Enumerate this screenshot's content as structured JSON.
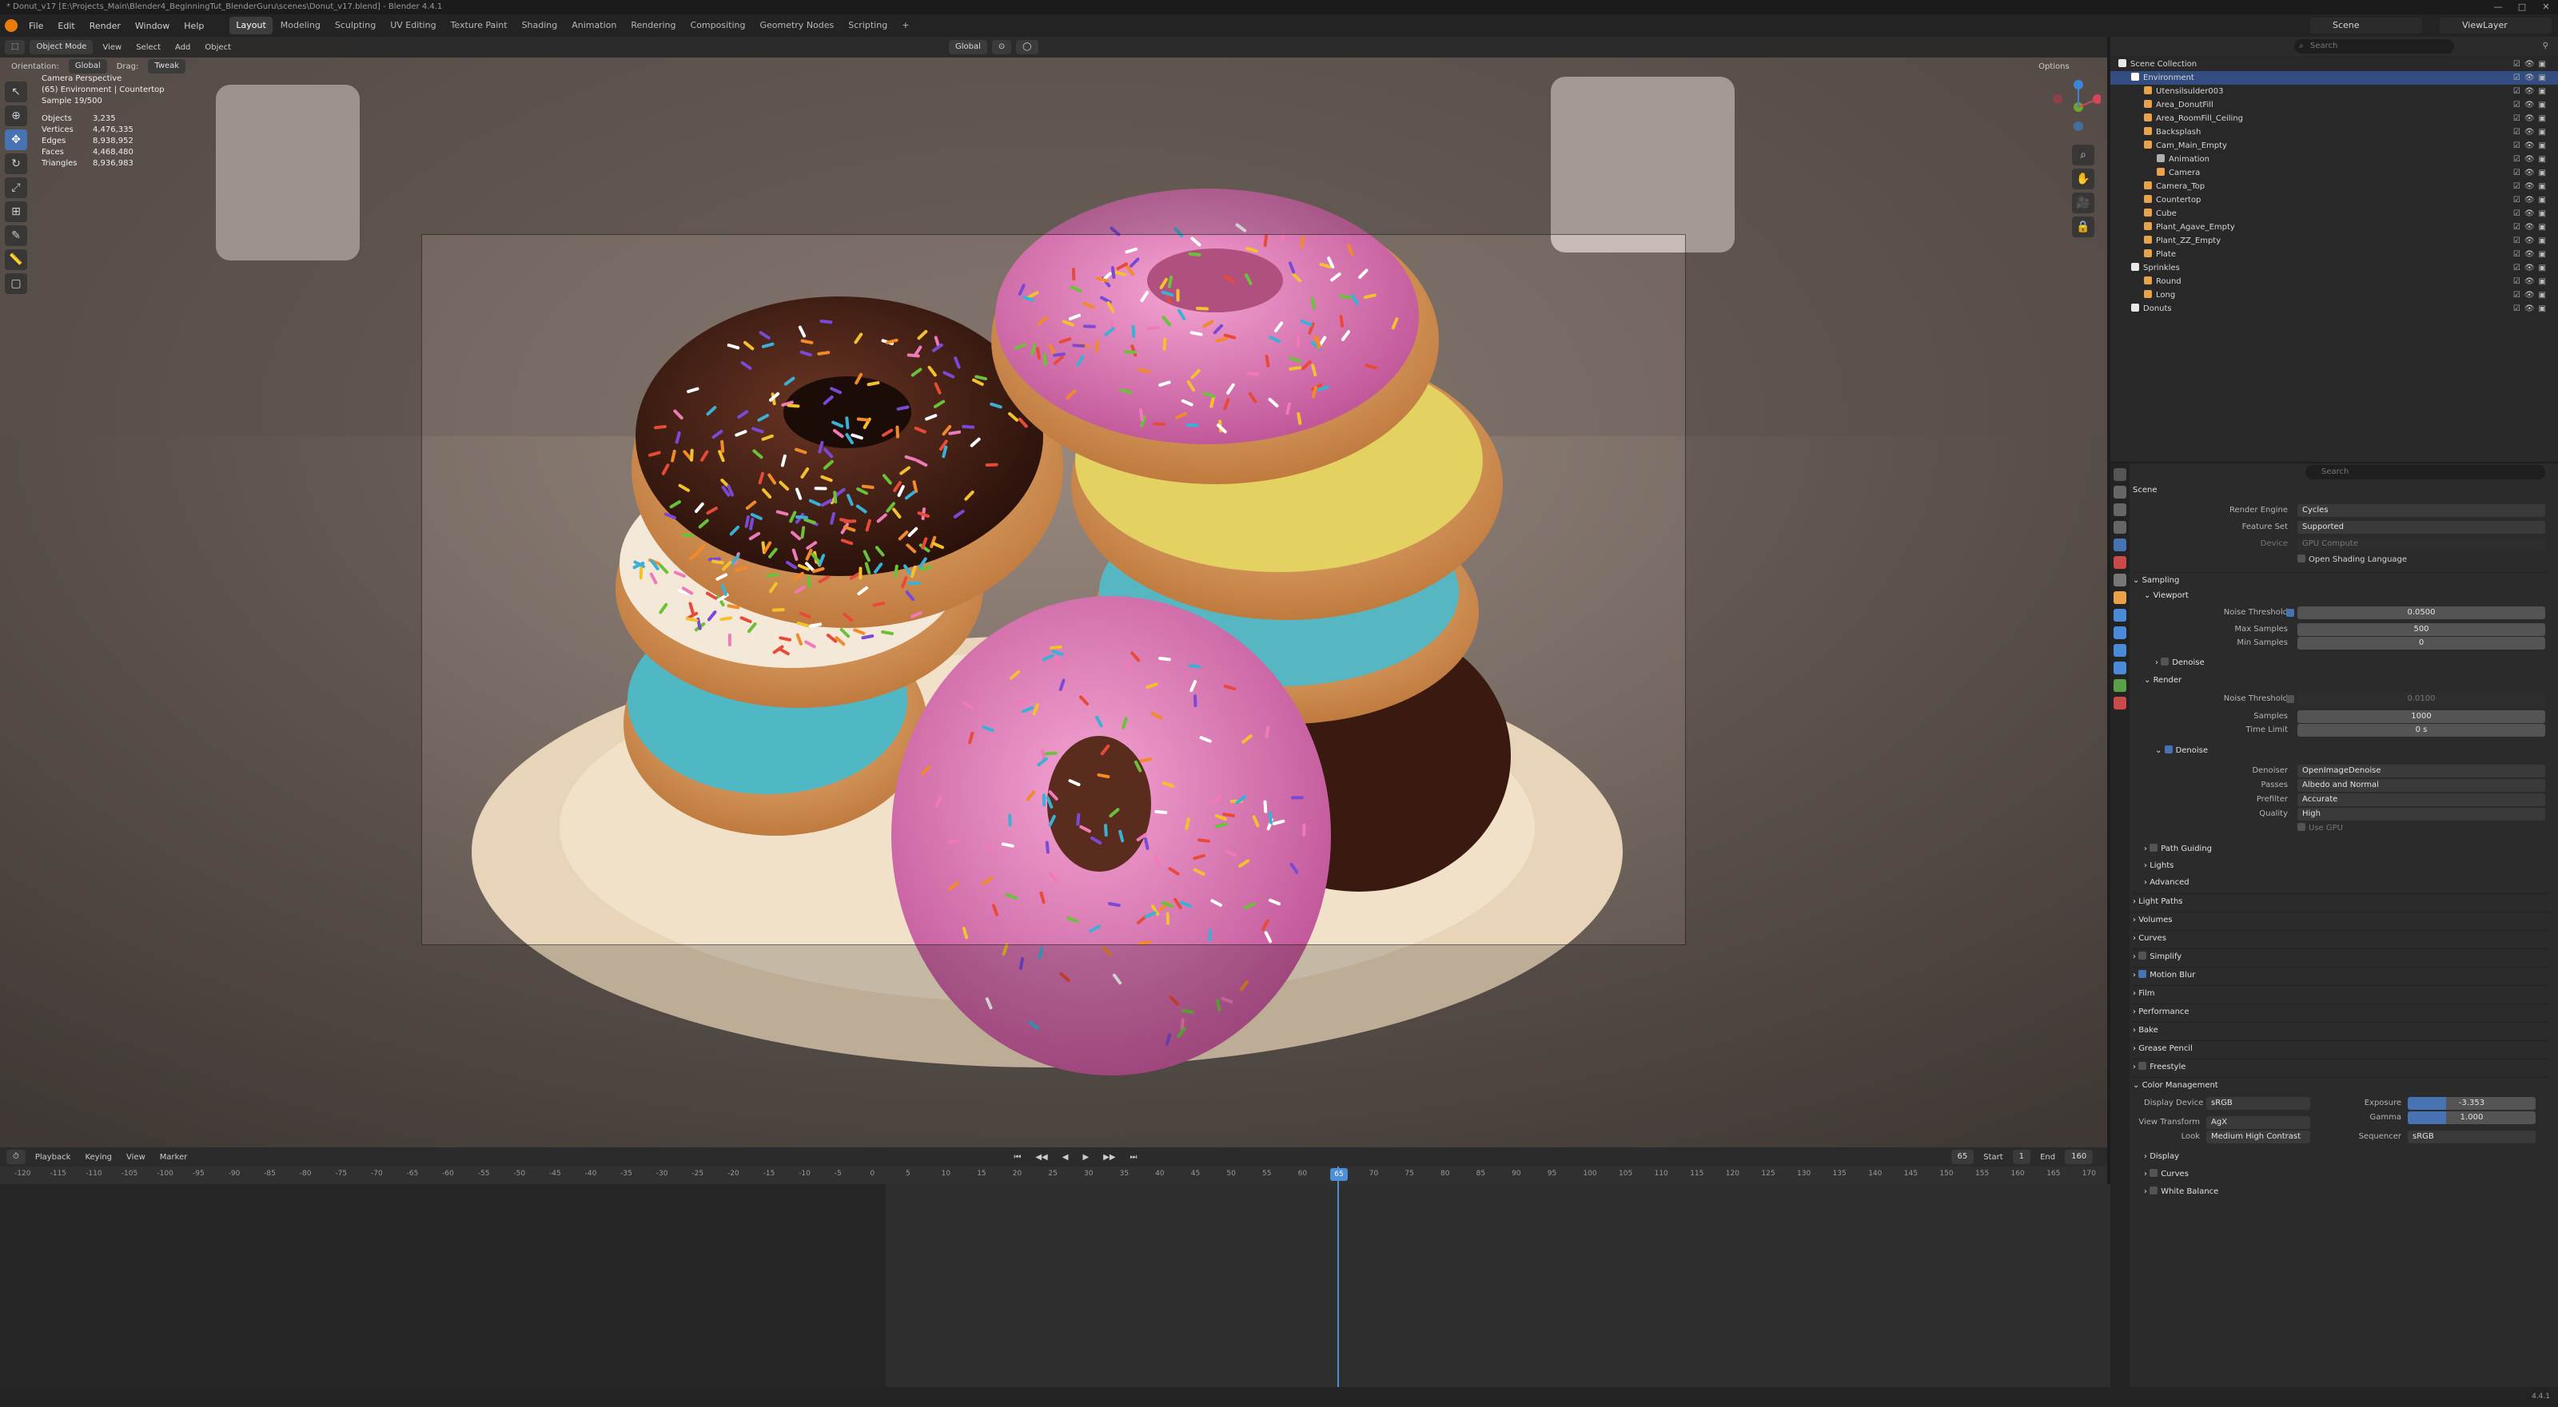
{
  "window": {
    "title": "* Donut_v17 [E:\\Projects_Main\\Blender4_BeginningTut_BlenderGuru\\scenes\\Donut_v17.blend] - Blender 4.4.1",
    "controls": [
      "—",
      "□",
      "✕"
    ]
  },
  "menu": {
    "items": [
      "File",
      "Edit",
      "Render",
      "Window",
      "Help"
    ],
    "workspaces": [
      "Layout",
      "Modeling",
      "Sculpting",
      "UV Editing",
      "Texture Paint",
      "Shading",
      "Animation",
      "Rendering",
      "Compositing",
      "Geometry Nodes",
      "Scripting"
    ],
    "active_workspace": "Layout",
    "add_workspace": "+",
    "scene": "Scene",
    "view_layer": "ViewLayer"
  },
  "viewport": {
    "mode": "Object Mode",
    "menus": [
      "View",
      "Select",
      "Add",
      "Object"
    ],
    "orientation_label": "Orientation:",
    "orientation": "Global",
    "drag_label": "Drag:",
    "drag": "Tweak",
    "transform": "Global",
    "options": "Options",
    "camera_info": [
      "Camera Perspective",
      "(65) Environment | Countertop",
      "Sample 19/500"
    ],
    "stats": [
      {
        "label": "Objects",
        "value": "3,235"
      },
      {
        "label": "Vertices",
        "value": "4,476,335"
      },
      {
        "label": "Edges",
        "value": "8,938,952"
      },
      {
        "label": "Faces",
        "value": "4,468,480"
      },
      {
        "label": "Triangles",
        "value": "8,936,983"
      }
    ]
  },
  "timeline": {
    "menus": [
      "Playback",
      "Keying",
      "View",
      "Marker"
    ],
    "current_frame": "65",
    "start_label": "Start",
    "start": "1",
    "end_label": "End",
    "end": "160",
    "ticks": [
      "-120",
      "-115",
      "-110",
      "-105",
      "-100",
      "-95",
      "-90",
      "-85",
      "-80",
      "-75",
      "-70",
      "-65",
      "-60",
      "-55",
      "-50",
      "-45",
      "-40",
      "-35",
      "-30",
      "-25",
      "-20",
      "-15",
      "-10",
      "-5",
      "0",
      "5",
      "10",
      "15",
      "20",
      "25",
      "30",
      "35",
      "40",
      "45",
      "50",
      "55",
      "60",
      "65",
      "70",
      "75",
      "80",
      "85",
      "90",
      "95",
      "100",
      "105",
      "110",
      "115",
      "120",
      "125",
      "130",
      "135",
      "140",
      "145",
      "150",
      "155",
      "160",
      "165",
      "170"
    ]
  },
  "outliner": {
    "search_placeholder": "Search",
    "rows": [
      {
        "label": "Scene Collection",
        "indent": 0,
        "color": "#e8e8e8"
      },
      {
        "label": "Environment",
        "indent": 1,
        "color": "#ffffff",
        "selected": true
      },
      {
        "label": "Utensilsulder003",
        "indent": 2,
        "color": "#e8a24a"
      },
      {
        "label": "Area_DonutFill",
        "indent": 2,
        "color": "#e8a24a"
      },
      {
        "label": "Area_RoomFill_Ceiling",
        "indent": 2,
        "color": "#e8a24a"
      },
      {
        "label": "Backsplash",
        "indent": 2,
        "color": "#e8a24a"
      },
      {
        "label": "Cam_Main_Empty",
        "indent": 2,
        "color": "#e8a24a"
      },
      {
        "label": "Animation",
        "indent": 3,
        "color": "#b0b0b0"
      },
      {
        "label": "Camera",
        "indent": 3,
        "color": "#e8a24a"
      },
      {
        "label": "Camera_Top",
        "indent": 2,
        "color": "#e8a24a"
      },
      {
        "label": "Countertop",
        "indent": 2,
        "color": "#e8a24a"
      },
      {
        "label": "Cube",
        "indent": 2,
        "color": "#e8a24a"
      },
      {
        "label": "Plant_Agave_Empty",
        "indent": 2,
        "color": "#e8a24a"
      },
      {
        "label": "Plant_ZZ_Empty",
        "indent": 2,
        "color": "#e8a24a"
      },
      {
        "label": "Plate",
        "indent": 2,
        "color": "#e8a24a"
      },
      {
        "label": "Sprinkles",
        "indent": 1,
        "color": "#e8e8e8"
      },
      {
        "label": "Round",
        "indent": 2,
        "color": "#e8a24a"
      },
      {
        "label": "Long",
        "indent": 2,
        "color": "#e8a24a"
      },
      {
        "label": "Donuts",
        "indent": 1,
        "color": "#e8e8e8"
      }
    ]
  },
  "properties": {
    "search_placeholder": "Search",
    "context": "Scene",
    "render_engine_label": "Render Engine",
    "render_engine": "Cycles",
    "feature_set_label": "Feature Set",
    "feature_set": "Supported",
    "device_label": "Device",
    "device": "GPU Compute",
    "osl": "Open Shading Language",
    "sampling": "Sampling",
    "viewport": "Viewport",
    "noise_threshold_label": "Noise Threshold",
    "vp_noise_threshold": "0.0500",
    "max_samples_label": "Max Samples",
    "vp_max_samples": "500",
    "min_samples_label": "Min Samples",
    "vp_min_samples": "0",
    "denoise": "Denoise",
    "render": "Render",
    "r_noise_threshold": "0.0100",
    "samples_label": "Samples",
    "r_samples": "1000",
    "time_limit_label": "Time Limit",
    "r_time_limit": "0 s",
    "denoiser_label": "Denoiser",
    "denoiser": "OpenImageDenoise",
    "passes_label": "Passes",
    "passes": "Albedo and Normal",
    "prefilter_label": "Prefilter",
    "prefilter": "Accurate",
    "quality_label": "Quality",
    "quality": "High",
    "use_gpu": "Use GPU",
    "sections": [
      "Path Guiding",
      "Lights",
      "Advanced",
      "Light Paths",
      "Volumes",
      "Curves",
      "Simplify",
      "Motion Blur",
      "Film",
      "Performance",
      "Bake",
      "Grease Pencil",
      "Freestyle",
      "Color Management"
    ],
    "display_device_label": "Display Device",
    "display_device": "sRGB",
    "view_transform_label": "View Transform",
    "view_transform": "AgX",
    "look_label": "Look",
    "look": "Medium High Contrast",
    "exposure_label": "Exposure",
    "exposure": "-3.353",
    "gamma_label": "Gamma",
    "gamma": "1.000",
    "sequencer_label": "Sequencer",
    "sequencer": "sRGB",
    "cm_sub": [
      "Display",
      "Curves",
      "White Balance"
    ]
  },
  "status": {
    "version": "4.4.1"
  }
}
